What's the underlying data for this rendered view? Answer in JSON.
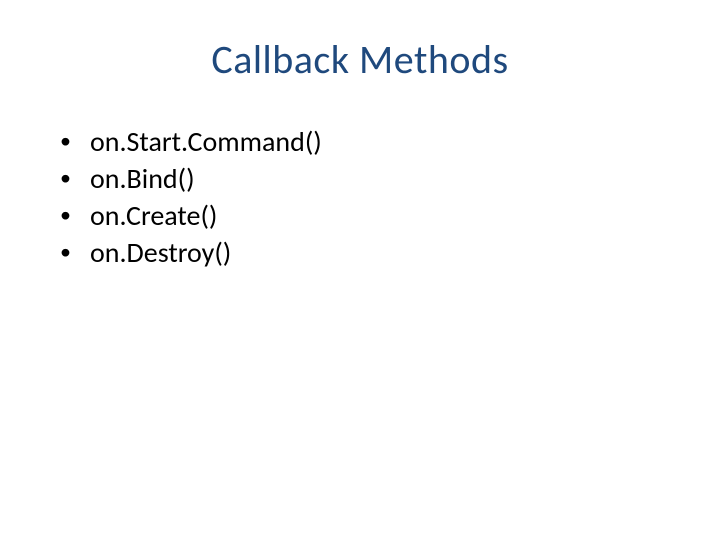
{
  "slide": {
    "title": "Callback Methods",
    "bullets": [
      "on.Start.Command()",
      "on.Bind()",
      "on.Create()",
      "on.Destroy()"
    ]
  }
}
